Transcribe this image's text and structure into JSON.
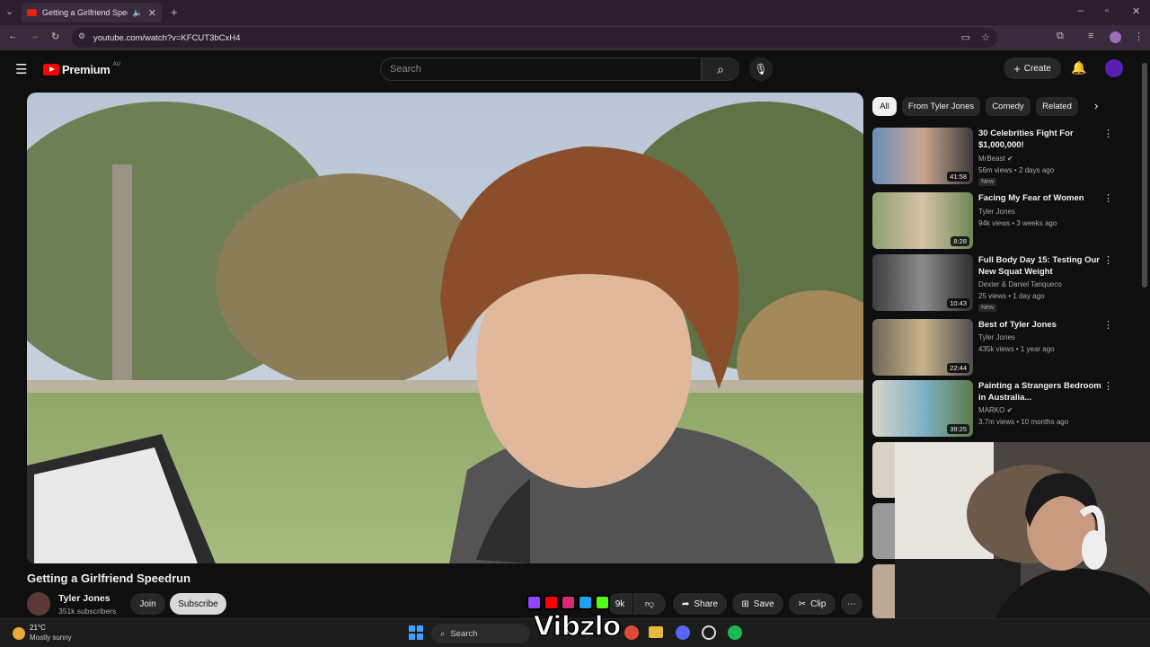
{
  "browser": {
    "tab_title": "Getting a Girlfriend Speedrun",
    "url": "youtube.com/watch?v=KFCUT3bCxH4"
  },
  "header": {
    "brand": "Premium",
    "region": "AU",
    "search_placeholder": "Search",
    "create_label": "Create"
  },
  "video": {
    "title": "Getting a Girlfriend Speedrun",
    "channel": "Tyler Jones",
    "subscribers": "351k subscribers",
    "join_label": "Join",
    "subscribe_label": "Subscribe",
    "likes": "9k",
    "share_label": "Share",
    "save_label": "Save",
    "clip_label": "Clip"
  },
  "chips": [
    "All",
    "From Tyler Jones",
    "Comedy",
    "Related"
  ],
  "recommended": [
    {
      "title": "30 Celebrities Fight For $1,000,000!",
      "channel": "MrBeast",
      "verified": true,
      "meta": "56m views • 2 days ago",
      "badge": "New",
      "duration": "41:58"
    },
    {
      "title": "Facing My Fear of Women",
      "channel": "Tyler Jones",
      "verified": false,
      "meta": "94k views • 3 weeks ago",
      "badge": "",
      "duration": "8:28"
    },
    {
      "title": "Full Body Day 15: Testing Our New Squat Weight",
      "channel": "Dexter & Daniel Tanqueco",
      "verified": false,
      "meta": "25 views • 1 day ago",
      "badge": "New",
      "duration": "10:43"
    },
    {
      "title": "Best of Tyler Jones",
      "channel": "Tyler Jones",
      "verified": false,
      "meta": "435k views • 1 year ago",
      "badge": "",
      "duration": "22:44"
    },
    {
      "title": "Painting a Strangers Bedroom in Australia...",
      "channel": "MARKO",
      "verified": true,
      "meta": "3.7m views • 10 months ago",
      "badge": "",
      "duration": "39:25"
    }
  ],
  "taskbar": {
    "temperature": "21°C",
    "weather": "Mostly sunny",
    "search_label": "Search"
  },
  "overlay": {
    "brand": "Vibzlo"
  }
}
